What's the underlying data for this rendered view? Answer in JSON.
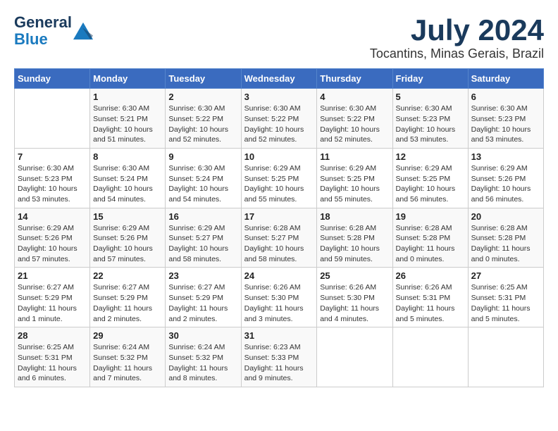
{
  "header": {
    "logo_line1": "General",
    "logo_line2": "Blue",
    "month": "July 2024",
    "location": "Tocantins, Minas Gerais, Brazil"
  },
  "days_of_week": [
    "Sunday",
    "Monday",
    "Tuesday",
    "Wednesday",
    "Thursday",
    "Friday",
    "Saturday"
  ],
  "weeks": [
    [
      {
        "day": "",
        "sunrise": "",
        "sunset": "",
        "daylight": ""
      },
      {
        "day": "1",
        "sunrise": "Sunrise: 6:30 AM",
        "sunset": "Sunset: 5:21 PM",
        "daylight": "Daylight: 10 hours and 51 minutes."
      },
      {
        "day": "2",
        "sunrise": "Sunrise: 6:30 AM",
        "sunset": "Sunset: 5:22 PM",
        "daylight": "Daylight: 10 hours and 52 minutes."
      },
      {
        "day": "3",
        "sunrise": "Sunrise: 6:30 AM",
        "sunset": "Sunset: 5:22 PM",
        "daylight": "Daylight: 10 hours and 52 minutes."
      },
      {
        "day": "4",
        "sunrise": "Sunrise: 6:30 AM",
        "sunset": "Sunset: 5:22 PM",
        "daylight": "Daylight: 10 hours and 52 minutes."
      },
      {
        "day": "5",
        "sunrise": "Sunrise: 6:30 AM",
        "sunset": "Sunset: 5:23 PM",
        "daylight": "Daylight: 10 hours and 53 minutes."
      },
      {
        "day": "6",
        "sunrise": "Sunrise: 6:30 AM",
        "sunset": "Sunset: 5:23 PM",
        "daylight": "Daylight: 10 hours and 53 minutes."
      }
    ],
    [
      {
        "day": "7",
        "sunrise": "Sunrise: 6:30 AM",
        "sunset": "Sunset: 5:23 PM",
        "daylight": "Daylight: 10 hours and 53 minutes."
      },
      {
        "day": "8",
        "sunrise": "Sunrise: 6:30 AM",
        "sunset": "Sunset: 5:24 PM",
        "daylight": "Daylight: 10 hours and 54 minutes."
      },
      {
        "day": "9",
        "sunrise": "Sunrise: 6:30 AM",
        "sunset": "Sunset: 5:24 PM",
        "daylight": "Daylight: 10 hours and 54 minutes."
      },
      {
        "day": "10",
        "sunrise": "Sunrise: 6:29 AM",
        "sunset": "Sunset: 5:25 PM",
        "daylight": "Daylight: 10 hours and 55 minutes."
      },
      {
        "day": "11",
        "sunrise": "Sunrise: 6:29 AM",
        "sunset": "Sunset: 5:25 PM",
        "daylight": "Daylight: 10 hours and 55 minutes."
      },
      {
        "day": "12",
        "sunrise": "Sunrise: 6:29 AM",
        "sunset": "Sunset: 5:25 PM",
        "daylight": "Daylight: 10 hours and 56 minutes."
      },
      {
        "day": "13",
        "sunrise": "Sunrise: 6:29 AM",
        "sunset": "Sunset: 5:26 PM",
        "daylight": "Daylight: 10 hours and 56 minutes."
      }
    ],
    [
      {
        "day": "14",
        "sunrise": "Sunrise: 6:29 AM",
        "sunset": "Sunset: 5:26 PM",
        "daylight": "Daylight: 10 hours and 57 minutes."
      },
      {
        "day": "15",
        "sunrise": "Sunrise: 6:29 AM",
        "sunset": "Sunset: 5:26 PM",
        "daylight": "Daylight: 10 hours and 57 minutes."
      },
      {
        "day": "16",
        "sunrise": "Sunrise: 6:29 AM",
        "sunset": "Sunset: 5:27 PM",
        "daylight": "Daylight: 10 hours and 58 minutes."
      },
      {
        "day": "17",
        "sunrise": "Sunrise: 6:28 AM",
        "sunset": "Sunset: 5:27 PM",
        "daylight": "Daylight: 10 hours and 58 minutes."
      },
      {
        "day": "18",
        "sunrise": "Sunrise: 6:28 AM",
        "sunset": "Sunset: 5:28 PM",
        "daylight": "Daylight: 10 hours and 59 minutes."
      },
      {
        "day": "19",
        "sunrise": "Sunrise: 6:28 AM",
        "sunset": "Sunset: 5:28 PM",
        "daylight": "Daylight: 11 hours and 0 minutes."
      },
      {
        "day": "20",
        "sunrise": "Sunrise: 6:28 AM",
        "sunset": "Sunset: 5:28 PM",
        "daylight": "Daylight: 11 hours and 0 minutes."
      }
    ],
    [
      {
        "day": "21",
        "sunrise": "Sunrise: 6:27 AM",
        "sunset": "Sunset: 5:29 PM",
        "daylight": "Daylight: 11 hours and 1 minute."
      },
      {
        "day": "22",
        "sunrise": "Sunrise: 6:27 AM",
        "sunset": "Sunset: 5:29 PM",
        "daylight": "Daylight: 11 hours and 2 minutes."
      },
      {
        "day": "23",
        "sunrise": "Sunrise: 6:27 AM",
        "sunset": "Sunset: 5:29 PM",
        "daylight": "Daylight: 11 hours and 2 minutes."
      },
      {
        "day": "24",
        "sunrise": "Sunrise: 6:26 AM",
        "sunset": "Sunset: 5:30 PM",
        "daylight": "Daylight: 11 hours and 3 minutes."
      },
      {
        "day": "25",
        "sunrise": "Sunrise: 6:26 AM",
        "sunset": "Sunset: 5:30 PM",
        "daylight": "Daylight: 11 hours and 4 minutes."
      },
      {
        "day": "26",
        "sunrise": "Sunrise: 6:26 AM",
        "sunset": "Sunset: 5:31 PM",
        "daylight": "Daylight: 11 hours and 5 minutes."
      },
      {
        "day": "27",
        "sunrise": "Sunrise: 6:25 AM",
        "sunset": "Sunset: 5:31 PM",
        "daylight": "Daylight: 11 hours and 5 minutes."
      }
    ],
    [
      {
        "day": "28",
        "sunrise": "Sunrise: 6:25 AM",
        "sunset": "Sunset: 5:31 PM",
        "daylight": "Daylight: 11 hours and 6 minutes."
      },
      {
        "day": "29",
        "sunrise": "Sunrise: 6:24 AM",
        "sunset": "Sunset: 5:32 PM",
        "daylight": "Daylight: 11 hours and 7 minutes."
      },
      {
        "day": "30",
        "sunrise": "Sunrise: 6:24 AM",
        "sunset": "Sunset: 5:32 PM",
        "daylight": "Daylight: 11 hours and 8 minutes."
      },
      {
        "day": "31",
        "sunrise": "Sunrise: 6:23 AM",
        "sunset": "Sunset: 5:33 PM",
        "daylight": "Daylight: 11 hours and 9 minutes."
      },
      {
        "day": "",
        "sunrise": "",
        "sunset": "",
        "daylight": ""
      },
      {
        "day": "",
        "sunrise": "",
        "sunset": "",
        "daylight": ""
      },
      {
        "day": "",
        "sunrise": "",
        "sunset": "",
        "daylight": ""
      }
    ]
  ]
}
